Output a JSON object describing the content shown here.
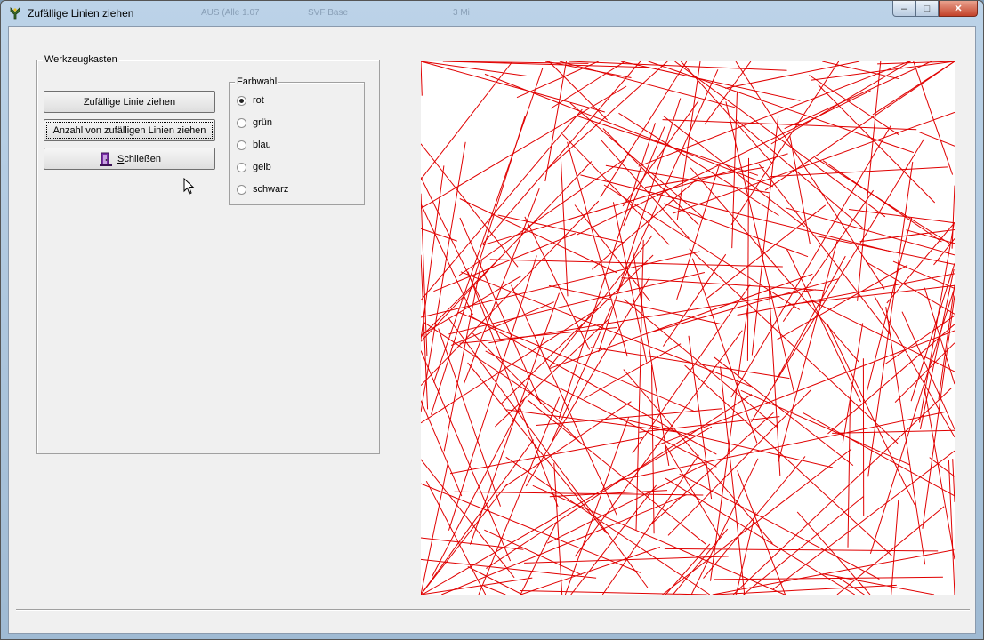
{
  "window": {
    "title": "Zufällige Linien ziehen",
    "controls": {
      "minimize": "–",
      "maximize": "□",
      "close": "✕"
    }
  },
  "background_text": [
    "AUS (Alle 1.07",
    "SVF Base",
    "3 Mi"
  ],
  "toolbox": {
    "legend": "Werkzeugkasten",
    "buttons": {
      "draw_line": "Zufällige Linie ziehen",
      "draw_many": "Anzahl von zufälligen Linien ziehen",
      "close_mnemonic": "S",
      "close_rest": "chließen"
    }
  },
  "color_choice": {
    "legend": "Farbwahl",
    "options": [
      "rot",
      "grün",
      "blau",
      "gelb",
      "schwarz"
    ],
    "selected": "rot"
  },
  "canvas": {
    "line_color": "#e00000",
    "line_count": 260
  },
  "colors": {
    "title_bar": "#bcd3e8",
    "client_bg": "#f0f0f0",
    "close_button": "#c3422a"
  }
}
